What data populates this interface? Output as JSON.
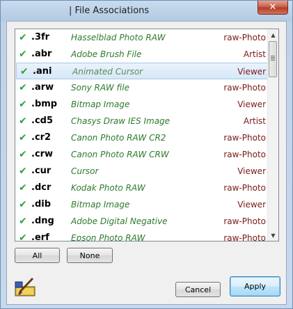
{
  "window": {
    "title": "| File Associations",
    "close_glyph": "✕"
  },
  "list": {
    "rows": [
      {
        "ext": ".3fr",
        "desc": "Hasselblad Photo RAW",
        "cat": "raw-Photo"
      },
      {
        "ext": ".abr",
        "desc": "Adobe Brush File",
        "cat": "Artist"
      },
      {
        "ext": ".ani",
        "desc": "Animated Cursor",
        "cat": "Viewer"
      },
      {
        "ext": ".arw",
        "desc": "Sony RAW file",
        "cat": "raw-Photo"
      },
      {
        "ext": ".bmp",
        "desc": "Bitmap Image",
        "cat": "Viewer"
      },
      {
        "ext": ".cd5",
        "desc": "Chasys Draw IES Image",
        "cat": "Artist"
      },
      {
        "ext": ".cr2",
        "desc": "Canon Photo RAW CR2",
        "cat": "raw-Photo"
      },
      {
        "ext": ".crw",
        "desc": "Canon Photo RAW CRW",
        "cat": "raw-Photo"
      },
      {
        "ext": ".cur",
        "desc": "Cursor",
        "cat": "Viewer"
      },
      {
        "ext": ".dcr",
        "desc": "Kodak Photo RAW",
        "cat": "raw-Photo"
      },
      {
        "ext": ".dib",
        "desc": "Bitmap Image",
        "cat": "Viewer"
      },
      {
        "ext": ".dng",
        "desc": "Adobe Digital Negative",
        "cat": "raw-Photo"
      },
      {
        "ext": ".erf",
        "desc": "Epson Photo RAW",
        "cat": "raw-Photo"
      }
    ],
    "check_glyph": "✔",
    "selected_index": 2
  },
  "buttons": {
    "all": "All",
    "none": "None",
    "cancel": "Cancel",
    "apply": "Apply"
  },
  "scrollbar": {
    "up_glyph": "▲",
    "down_glyph": "▼"
  },
  "colors": {
    "check": "#2ea23a",
    "description": "#2d7a2d",
    "category": "#7a1919",
    "selection": "#d6e8f8"
  }
}
